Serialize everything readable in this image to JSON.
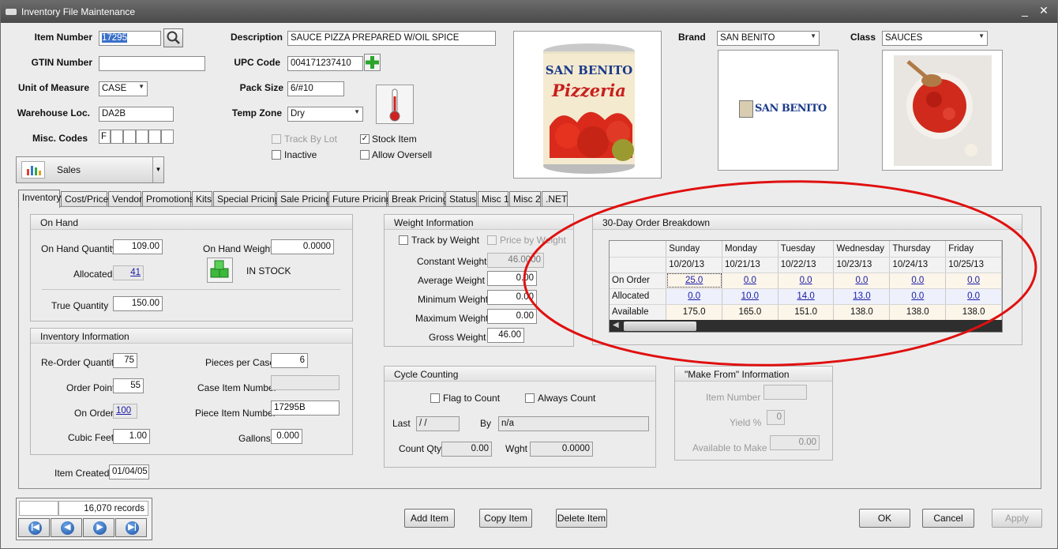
{
  "window": {
    "title": "Inventory File Maintenance",
    "min_glyph": "_",
    "close_glyph": "✕"
  },
  "header": {
    "item_number_label": "Item Number",
    "item_number": "17295",
    "gtin_label": "GTIN Number",
    "gtin": "",
    "uom_label": "Unit of Measure",
    "uom": "CASE",
    "warehouse_label": "Warehouse Loc.",
    "warehouse": "DA2B",
    "misc_label": "Misc. Codes",
    "misc_codes": [
      "F",
      "",
      "",
      "",
      "",
      ""
    ],
    "description_label": "Description",
    "description": "SAUCE PIZZA PREPARED W/OIL SPICE",
    "upc_label": "UPC Code",
    "upc": "004171237410",
    "pack_size_label": "Pack Size",
    "pack_size": "6/#10",
    "temp_zone_label": "Temp Zone",
    "temp_zone": "Dry",
    "brand_label": "Brand",
    "brand": "SAN BENITO",
    "class_label": "Class",
    "class_value": "SAUCES",
    "brand_logo_text": "SAN BENITO",
    "can_brand_text": "SAN BENITO",
    "can_product_text": "Pizzeria"
  },
  "flags": {
    "track_by_lot": "Track By Lot",
    "inactive": "Inactive",
    "stock_item": "Stock Item",
    "allow_oversell": "Allow Oversell",
    "stock_item_checked": "✓"
  },
  "module_selector": {
    "label": "Sales"
  },
  "tabs": [
    "Inventory",
    "Cost/Price",
    "Vendor",
    "Promotions",
    "Kits",
    "Special Pricing",
    "Sale Pricing",
    "Future Pricing",
    "Break Pricing",
    "Status",
    "Misc 1",
    "Misc 2",
    ".NET"
  ],
  "on_hand": {
    "title": "On Hand",
    "qty_label": "On Hand Quantity",
    "qty": "109.00",
    "weight_label": "On Hand Weight",
    "weight": "0.0000",
    "allocated_label": "Allocated",
    "allocated": "41",
    "status": "IN STOCK",
    "true_qty_label": "True Quantity",
    "true_qty": "150.00"
  },
  "inventory_info": {
    "title": "Inventory Information",
    "reorder_label": "Re-Order Quantity",
    "reorder": "75",
    "order_point_label": "Order Point",
    "order_point": "55",
    "on_order_label": "On Order",
    "on_order": "100",
    "cubic_label": "Cubic Feet",
    "cubic": "1.00",
    "pieces_label": "Pieces per Case",
    "pieces": "6",
    "case_item_label": "Case Item Number",
    "case_item": "",
    "piece_item_label": "Piece Item Number",
    "piece_item": "17295B",
    "gallons_label": "Gallons",
    "gallons": "0.000"
  },
  "item_created": {
    "label": "Item Created:",
    "value": "01/04/05"
  },
  "weight_info": {
    "title": "Weight Information",
    "track_label": "Track by Weight",
    "price_label": "Price by Weight",
    "constant_label": "Constant Weight",
    "constant": "46.0000",
    "average_label": "Average Weight",
    "average": "0.00",
    "minimum_label": "Minimum Weight",
    "minimum": "0.00",
    "maximum_label": "Maximum Weight",
    "maximum": "0.00",
    "gross_label": "Gross Weight",
    "gross": "46.00"
  },
  "cycle": {
    "title": "Cycle Counting",
    "flag_label": "Flag to Count",
    "always_label": "Always Count",
    "last_label": "Last",
    "last": " / /",
    "by_label": "By",
    "by": "n/a",
    "count_label": "Count Qty",
    "count": "0.00",
    "wght_label": "Wght",
    "wght": "0.0000"
  },
  "make_from": {
    "title": "\"Make From\" Information",
    "item_label": "Item Number",
    "item": "",
    "yield_label": "Yield %",
    "yield": "0",
    "avail_label": "Available to Make",
    "avail": "0.00"
  },
  "breakdown": {
    "title": "30-Day Order Breakdown",
    "days": [
      "Sunday",
      "Monday",
      "Tuesday",
      "Wednesday",
      "Thursday",
      "Friday"
    ],
    "dates": [
      "10/20/13",
      "10/21/13",
      "10/22/13",
      "10/23/13",
      "10/24/13",
      "10/25/13"
    ],
    "row_labels": [
      "On Order",
      "Allocated",
      "Available"
    ],
    "on_order": [
      "25.0",
      "0.0",
      "0.0",
      "0.0",
      "0.0",
      "0.0"
    ],
    "allocated": [
      "0.0",
      "10.0",
      "14.0",
      "13.0",
      "0.0",
      "0.0"
    ],
    "available": [
      "175.0",
      "165.0",
      "151.0",
      "138.0",
      "138.0",
      "138.0"
    ]
  },
  "records": {
    "count": "16,070 records"
  },
  "buttons": {
    "add": "Add Item",
    "copy": "Copy Item",
    "delete": "Delete Item",
    "ok": "OK",
    "cancel": "Cancel",
    "apply": "Apply"
  },
  "colors": {
    "annotation_circle": "#e01010",
    "link": "#1a1aa8"
  }
}
